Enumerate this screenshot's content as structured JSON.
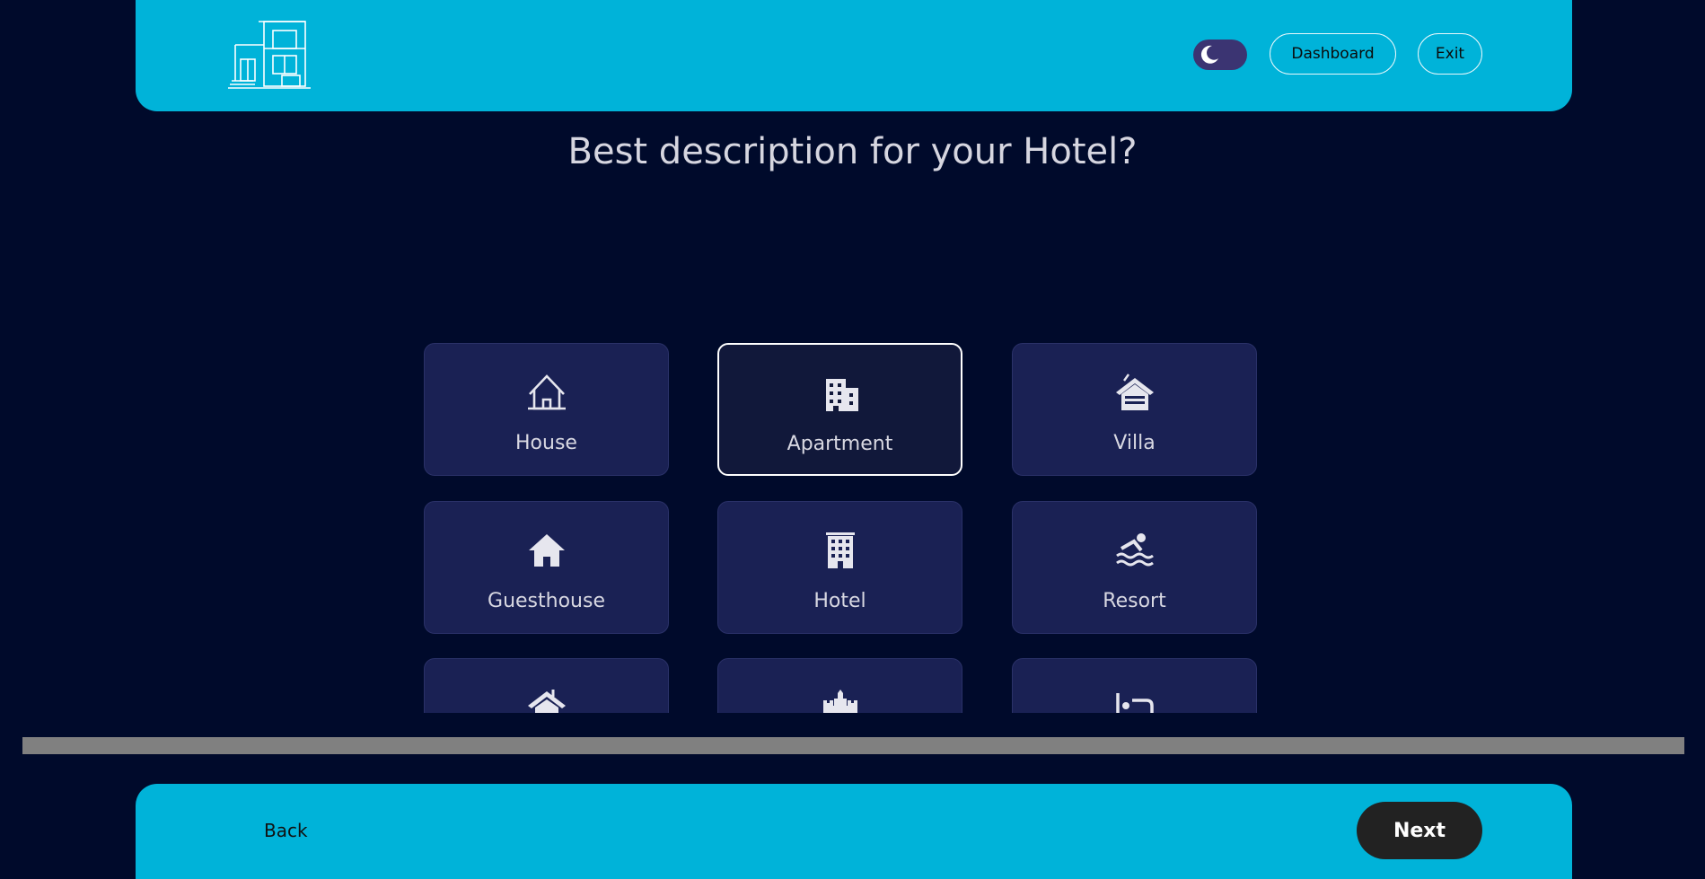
{
  "header": {
    "dashboard_label": "Dashboard",
    "exit_label": "Exit",
    "theme_toggle_icon": "moon-icon",
    "logo_icon": "building-logo-icon"
  },
  "page": {
    "title": "Best description for your Hotel?"
  },
  "options": [
    {
      "label": "House",
      "icon": "house-outline-icon",
      "selected": false
    },
    {
      "label": "Apartment",
      "icon": "apartment-building-icon",
      "selected": true
    },
    {
      "label": "Villa",
      "icon": "villa-icon",
      "selected": false
    },
    {
      "label": "Guesthouse",
      "icon": "house-solid-icon",
      "selected": false
    },
    {
      "label": "Hotel",
      "icon": "hotel-building-icon",
      "selected": false
    },
    {
      "label": "Resort",
      "icon": "swimmer-icon",
      "selected": false
    },
    {
      "label": "",
      "icon": "cabin-roof-icon",
      "selected": false
    },
    {
      "label": "",
      "icon": "castle-icon",
      "selected": false
    },
    {
      "label": "",
      "icon": "bed-icon",
      "selected": false
    }
  ],
  "footer": {
    "back_label": "Back",
    "next_label": "Next"
  },
  "colors": {
    "background": "#000a2b",
    "accent": "#00b3d9",
    "card": "#1a2154",
    "toggle": "#3b3472"
  }
}
